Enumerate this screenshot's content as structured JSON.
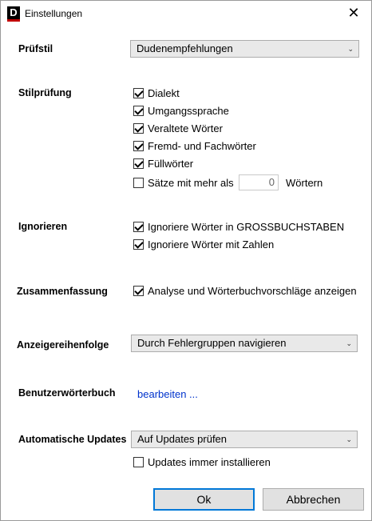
{
  "window": {
    "title": "Einstellungen",
    "app_icon_letter": "D",
    "close_glyph": "✕"
  },
  "pruefstil": {
    "label": "Prüfstil",
    "selected": "Dudenempfehlungen"
  },
  "stilpruefung": {
    "label": "Stilprüfung",
    "options": [
      {
        "label": "Dialekt",
        "checked": true
      },
      {
        "label": "Umgangssprache",
        "checked": true
      },
      {
        "label": "Veraltete Wörter",
        "checked": true
      },
      {
        "label": "Fremd- und Fachwörter",
        "checked": true
      },
      {
        "label": "Füllwörter",
        "checked": true
      }
    ],
    "saetze": {
      "label_before": "Sätze mit mehr als",
      "value": "0",
      "label_after": "Wörtern",
      "checked": false
    }
  },
  "ignorieren": {
    "label": "Ignorieren",
    "options": [
      {
        "label": "Ignoriere Wörter in GROSSBUCHSTABEN",
        "checked": true
      },
      {
        "label": "Ignoriere Wörter mit Zahlen",
        "checked": true
      }
    ]
  },
  "zusammenfassung": {
    "label": "Zusammenfassung",
    "option": {
      "label": "Analyse und Wörterbuchvorschläge anzeigen",
      "checked": true
    }
  },
  "anzeigereihenfolge": {
    "label": "Anzeigereihenfolge",
    "selected": "Durch Fehlergruppen navigieren"
  },
  "benutzerwoerterbuch": {
    "label": "Benutzerwörterbuch",
    "link": "bearbeiten ..."
  },
  "updates": {
    "label": "Automatische Updates",
    "selected": "Auf Updates prüfen",
    "option": {
      "label": "Updates immer installieren",
      "checked": false
    }
  },
  "buttons": {
    "ok": "Ok",
    "cancel": "Abbrechen"
  }
}
